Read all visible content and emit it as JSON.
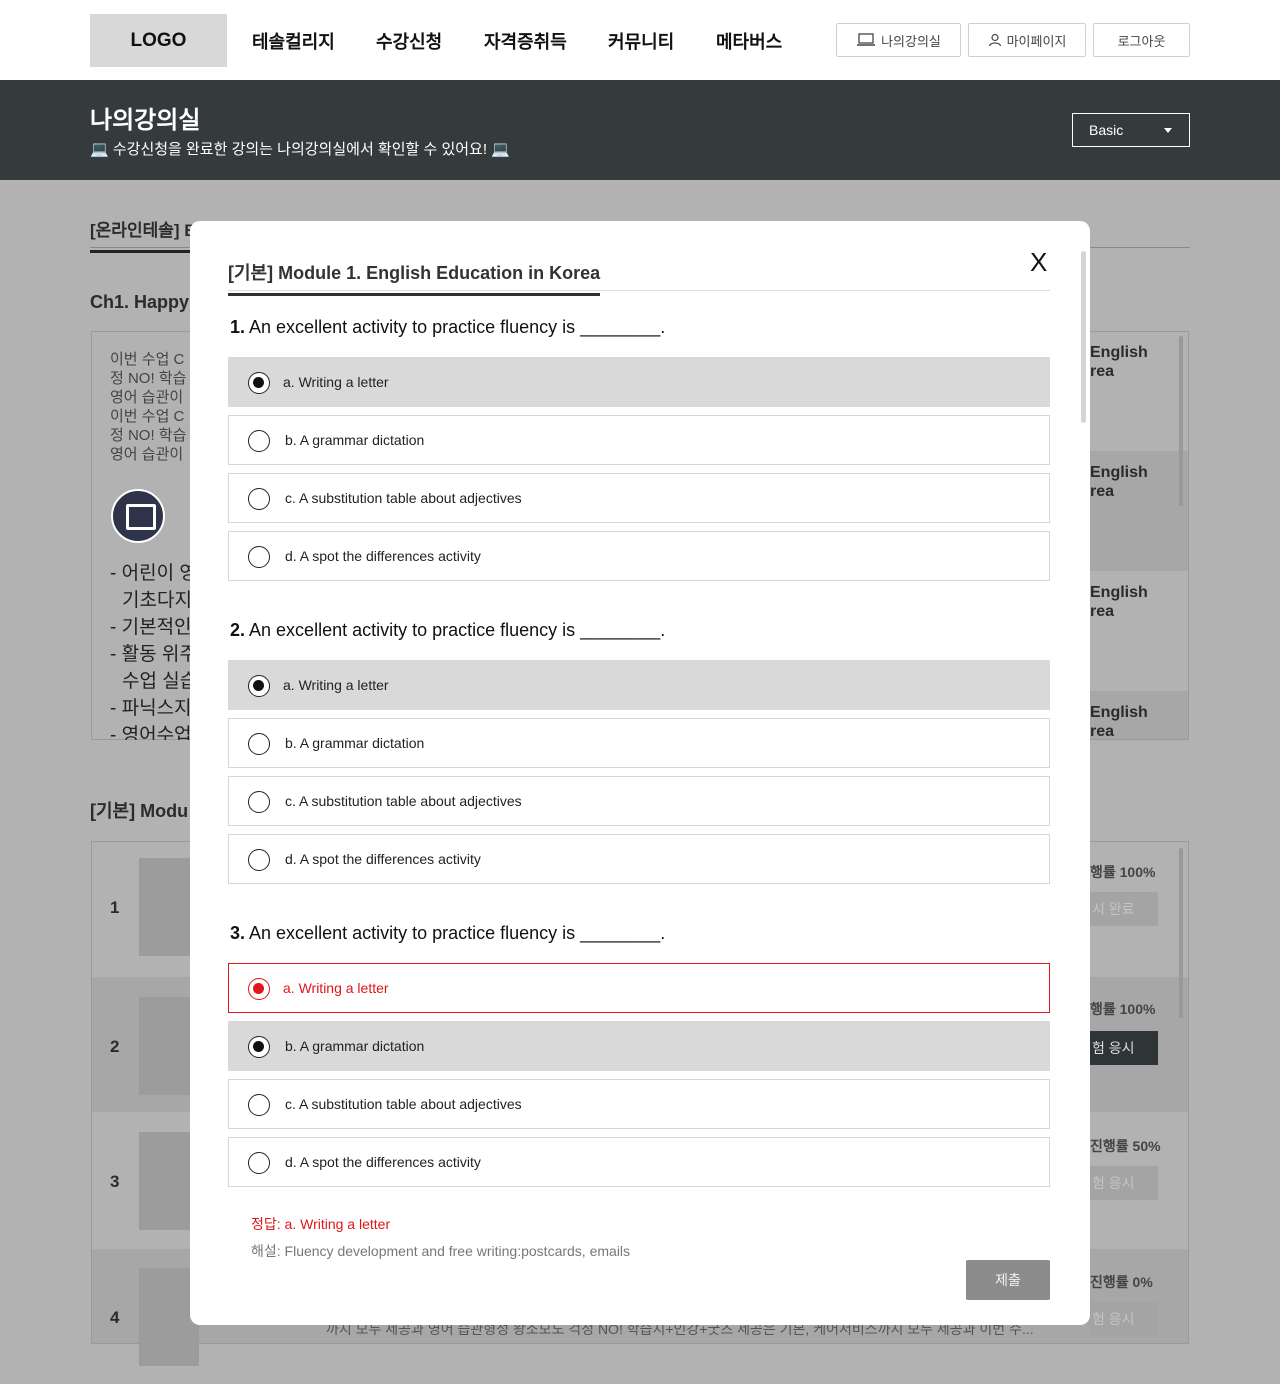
{
  "header": {
    "logo": "LOGO",
    "nav": [
      "테솔컬리지",
      "수강신청",
      "자격증취득",
      "커뮤니티",
      "메타버스"
    ],
    "buttons": {
      "my_classroom": "나의강의실",
      "my_page": "마이페이지",
      "logout": "로그아웃"
    }
  },
  "banner": {
    "title": "나의강의실",
    "subtitle": "💻 수강신청을 완료한 강의는 나의강의실에서 확인할 수 있어요! 💻",
    "select_value": "Basic"
  },
  "background": {
    "tab": "[온라인테솔] Basic",
    "chapter": "Ch1. Happy",
    "desc_lines": [
      "이번 수업 C",
      "정 NO! 학습",
      "영어 습관이",
      "이번 수업 C",
      "정 NO! 학습",
      "영어 습관이"
    ],
    "list_lines": [
      "- 어린이 영",
      "  기초다지",
      "- 기본적인",
      "- 활동 위주",
      "  수업 실습",
      "- 파닉스지",
      "- 영어수업"
    ],
    "english_items": [
      "English\nrea",
      "English\nrea",
      "English\nrea",
      "English\nrea"
    ],
    "section2": "[기본] Modu",
    "rows": [
      {
        "num": "1",
        "progress": "행률 100%",
        "action": "시 완료"
      },
      {
        "num": "2",
        "progress": "행률 100%",
        "action": "험 응시"
      },
      {
        "num": "3",
        "progress": "진행률 50%",
        "action": "험 응시"
      },
      {
        "num": "4",
        "progress": "진행률 0%",
        "action": "험 응시"
      }
    ],
    "bottom_text": "까지 모두 제공과 영어 습관형성 왕소모도 걱정 NO! 학습지+인강+굿즈 제공은 기본, 케어서비스까지 모두 제공과 이번 수..."
  },
  "modal": {
    "title": "[기본] Module 1. English Education in Korea",
    "close": "X",
    "questions": [
      {
        "number": "1.",
        "text": "An excellent activity to practice fluency is ________.",
        "options": [
          {
            "label": "a. Writing a letter",
            "state": "selected"
          },
          {
            "label": "b. A grammar dictation",
            "state": "none"
          },
          {
            "label": "c. A substitution table about adjectives",
            "state": "none"
          },
          {
            "label": "d. A spot the differences activity",
            "state": "none"
          }
        ]
      },
      {
        "number": "2.",
        "text": "An excellent activity to practice fluency is ________.",
        "options": [
          {
            "label": "a. Writing a letter",
            "state": "selected"
          },
          {
            "label": "b. A grammar dictation",
            "state": "none"
          },
          {
            "label": "c. A substitution table about adjectives",
            "state": "none"
          },
          {
            "label": "d. A spot the differences activity",
            "state": "none"
          }
        ]
      },
      {
        "number": "3.",
        "text": "An excellent activity to practice fluency is ________.",
        "options": [
          {
            "label": "a. Writing a letter",
            "state": "correct-answer"
          },
          {
            "label": "b. A grammar dictation",
            "state": "selected"
          },
          {
            "label": "c. A substitution table about adjectives",
            "state": "none"
          },
          {
            "label": "d. A spot the differences activity",
            "state": "none"
          }
        ]
      }
    ],
    "answer": "정답: a. Writing a letter",
    "explanation": "해설: Fluency development and free writing:postcards, emails",
    "submit": "제출"
  },
  "colors": {
    "banner_bg": "#353b3d",
    "overlay": "#b2b2b2",
    "wrong": "#e0161a",
    "submit_bg": "#8c8c8c"
  }
}
